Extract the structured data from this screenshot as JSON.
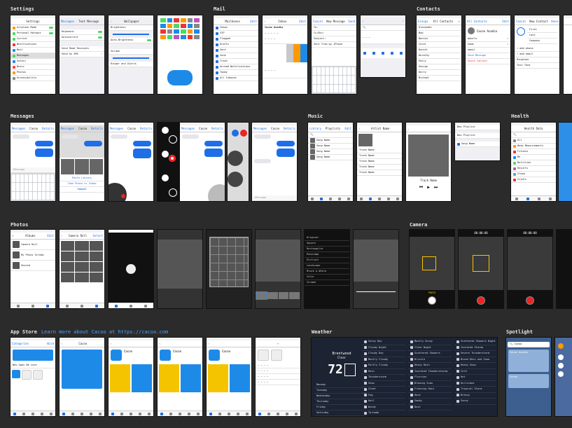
{
  "sections": {
    "settings": "Settings",
    "mail": "Mail",
    "contacts": "Contacts",
    "messages": "Messages",
    "music": "Music",
    "health": "Health",
    "photos": "Photos",
    "camera": "Camera",
    "appstore": "App Store",
    "appstore_link": "Learn more about Cacoo at https://cacoo.com",
    "weather": "Weather",
    "spotlight": "Spotlight"
  },
  "settings_screens": {
    "s1_title": "Settings",
    "s1_rows": [
      "Airplane Mode",
      "Personal Hotspot",
      "Carrier",
      "Notifications",
      "Mail",
      "Messages",
      "Safari",
      "Music",
      "Photos",
      "Accessibility"
    ],
    "s2_back": "Messages",
    "s2_title": "Text Message",
    "s2_rows": [
      "Keyboard",
      "Autocorrect",
      "Send Read Receipts",
      "Send As SMS"
    ],
    "s3_title": "Wallpaper",
    "s3_rows": [
      "Brightness",
      "Auto-Brightness",
      "Volume",
      "Ringer and Alerts"
    ]
  },
  "mail_screens": {
    "m1_title": "Mailboxes",
    "m1_rows": [
      "Inbox",
      "VIP",
      "Flagged",
      "Drafts",
      "Sent",
      "Junk",
      "Trash",
      "Unread Notifications",
      "Today",
      "All Inboxes"
    ],
    "m2_title": "Inbox",
    "m2_sender": "Cacoo Acadia",
    "m3_title": "New Message",
    "m3_rows": [
      "To:",
      "Cc/Bcc:",
      "Subject:",
      "Sent from my iPhone"
    ]
  },
  "contacts_screens": {
    "c1_title": "All Contacts",
    "c1_rows": [
      "Alexander",
      "Bob",
      "Bonnie",
      "Carol",
      "Daniel",
      "Dorothy",
      "Emily",
      "George",
      "Harry",
      "Michael"
    ],
    "c2_title": "All Contacts",
    "c2_name": "Cacoo Acadia",
    "c2_rows": [
      "mobile",
      "home",
      "email",
      "Send Message",
      "Share Contact"
    ],
    "c3_title": "New Contact",
    "c3_rows": [
      "First",
      "Last",
      "Company",
      "add phone",
      "add email",
      "Ringtone",
      "Text Tone"
    ]
  },
  "messages_screens": {
    "back": "Messages",
    "contact": "Cacoo",
    "detail": "Details",
    "placeholder": "iMessage",
    "sheet_items": [
      "Photo Library",
      "Take Photo or Video",
      "Cancel"
    ]
  },
  "music_screens": {
    "m1_left": "Library",
    "m1_title": "Playlists",
    "m1_rows": [
      "Song Name",
      "Song Name",
      "Song Name",
      "Song Name"
    ],
    "m2_title": "Artist Name",
    "m2_rows": [
      "Track Name",
      "Track Name",
      "Track Name",
      "Track Name",
      "Track Name"
    ],
    "m3_title": "Track Name",
    "m4_rows": [
      "New Playlist",
      "New Playlist",
      "Song Name"
    ]
  },
  "health_screens": {
    "h_title": "Health Data",
    "h_rows": [
      "All",
      "Body Measurements",
      "Fitness",
      "Me",
      "Nutrition",
      "Results",
      "Sleep",
      "Vitals"
    ]
  },
  "photos_screens": {
    "p_title": "Albums",
    "p_rows": [
      "Camera Roll",
      "My Photo Stream",
      "Shared"
    ],
    "p2_title": "Camera Roll",
    "edit_menu": [
      "Original",
      "Square",
      "Rectangular",
      "Panorama",
      "Portrait",
      "Landscape",
      "Black & White",
      "Color",
      "Chrome"
    ]
  },
  "camera_screens": {
    "timer": "00:00:00",
    "modes": "PHOTO"
  },
  "appstore_screens": {
    "tabs": [
      "Featured",
      "Top Charts",
      "Explore",
      "Search",
      "Updates"
    ],
    "app_name": "Cacoo",
    "section_label": "New Apps We Love"
  },
  "weather_screen": {
    "city": "Brentwood",
    "condition": "Clear",
    "temp": "72",
    "days": [
      "Monday",
      "Tuesday",
      "Wednesday",
      "Thursday",
      "Friday",
      "Saturday"
    ],
    "icons_col1": [
      "Sunny Day",
      "Cloudy Night",
      "Cloudy Day",
      "Mostly Cloudy",
      "Partly Cloudy",
      "Rain",
      "Thunderstorm",
      "Snow",
      "Sleet",
      "Fog",
      "Hail",
      "Windy",
      "Tornado"
    ],
    "icons_col2": [
      "Mostly Sunny",
      "Clear Night",
      "Scattered Showers",
      "Drizzle",
      "Heavy Rain",
      "Isolated Thunderstorms",
      "Flurries",
      "Blowing Snow",
      "Freezing Rain",
      "Haze",
      "Smoky",
      "Dust"
    ],
    "icons_col3": [
      "Scattered Showers Night",
      "Isolated Storms",
      "Severe Thunderstorm",
      "Mixed Rain and Snow",
      "Heavy Snow",
      "Cold",
      "Hot",
      "Hurricane",
      "Tropical Storm",
      "Breezy",
      "Sunny"
    ]
  },
  "spotlight_screen": {
    "query": "Cacoo",
    "result_title": "Cacoo Acadia",
    "app_result": "Cacoo"
  }
}
